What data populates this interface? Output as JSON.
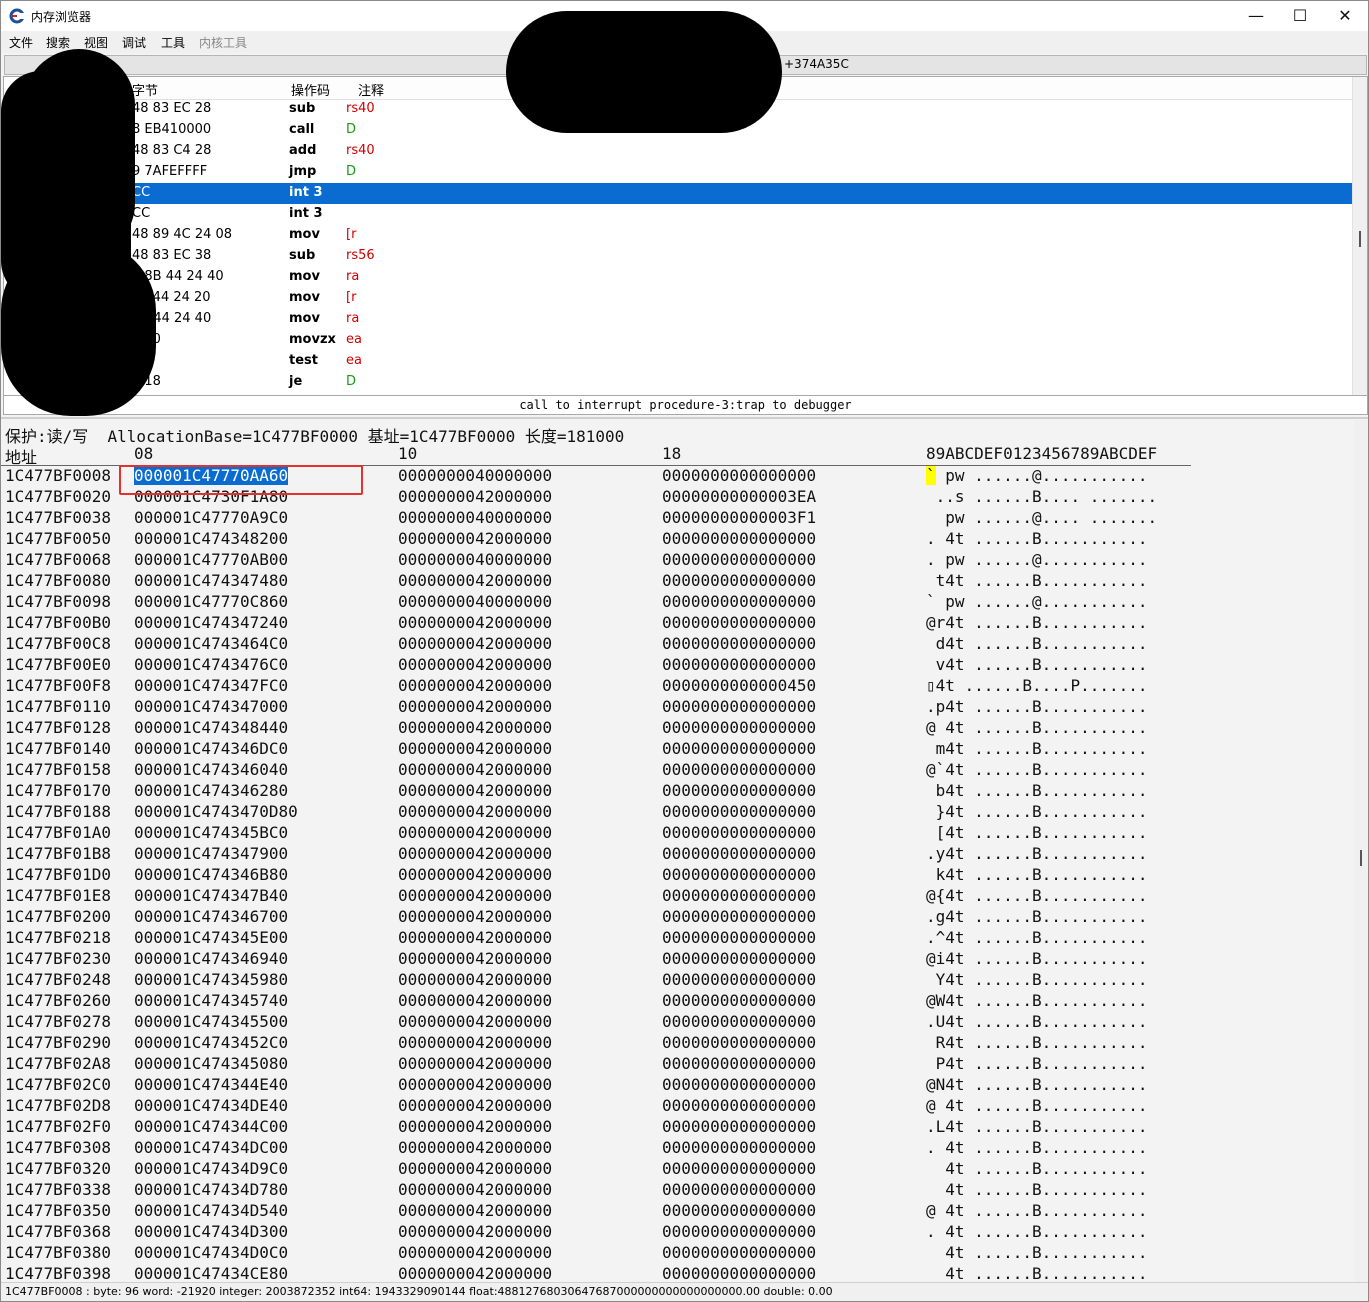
{
  "window": {
    "title": "内存浏览器",
    "controls": {
      "minimize": "—",
      "maximize": "☐",
      "close": "✕"
    }
  },
  "menu": [
    "文件",
    "搜索",
    "视图",
    "调试",
    "工具",
    "内核工具"
  ],
  "address_bar": "+374A35C",
  "disasm": {
    "headers": {
      "bytes": "字节",
      "opcode": "操作码",
      "comment": "注释"
    },
    "rows": [
      {
        "bytes": "48 83 EC 28",
        "op": "sub",
        "comment": "rs40",
        "color": "red"
      },
      {
        "bytes": "8 EB410000",
        "op": "call",
        "comment": "D",
        "color": "green"
      },
      {
        "bytes": "48 83 C4 28",
        "op": "add",
        "comment": "rs40",
        "color": "red"
      },
      {
        "bytes": "9 7AFEFFFF",
        "op": "jmp",
        "comment": "D",
        "color": "green"
      },
      {
        "bytes": "CC",
        "op": "int 3",
        "comment": "",
        "color": "red",
        "selected": true
      },
      {
        "bytes": "CC",
        "op": "int 3",
        "comment": "",
        "color": "red"
      },
      {
        "bytes": "48 89 4C 24 08",
        "op": "mov",
        "comment": "[r",
        "color": "red"
      },
      {
        "bytes": "48 83 EC 38",
        "op": "sub",
        "comment": "rs56",
        "color": "red"
      },
      {
        "bytes": "8 8B 44 24 40",
        "op": "mov",
        "comment": "ra",
        "color": "red"
      },
      {
        "bytes": "89 44 24 20",
        "op": "mov",
        "comment": "[r",
        "color": "red"
      },
      {
        "bytes": "8B 44 24 40",
        "op": "mov",
        "comment": "ra",
        "color": "red"
      },
      {
        "bytes": "6 00",
        "op": "movzx",
        "comment": "ea",
        "color": "red"
      },
      {
        "bytes": "C0",
        "op": "test",
        "comment": "ea",
        "color": "red"
      },
      {
        "bytes": "4 18",
        "op": "je",
        "comment": "D",
        "color": "green"
      }
    ]
  },
  "info_line": "call to interrupt procedure-3:trap to debugger",
  "hex": {
    "info": "保护:读/写  AllocationBase=1C477BF0000 基址=1C477BF0000 长度=181000",
    "headers": {
      "addr": "地址",
      "c0": "08",
      "c1": "10",
      "c2": "18",
      "ascii": "89ABCDEF0123456789ABCDEF"
    },
    "rows": [
      {
        "addr": "1C477BF0008",
        "c0": "000001C47770AA60",
        "c1": "0000000040000000",
        "c2": "0000000000000000",
        "ascii": "` pw ......@..........."
      },
      {
        "addr": "1C477BF0020",
        "c0": "000001C4730F1A80",
        "c1": "0000000042000000",
        "c2": "00000000000003EA",
        "ascii": " ..s ......B.... ......."
      },
      {
        "addr": "1C477BF0038",
        "c0": "000001C47770A9C0",
        "c1": "0000000040000000",
        "c2": "00000000000003F1",
        "ascii": "  pw ......@.... ......."
      },
      {
        "addr": "1C477BF0050",
        "c0": "000001C474348200",
        "c1": "0000000042000000",
        "c2": "0000000000000000",
        "ascii": ". 4t ......B..........."
      },
      {
        "addr": "1C477BF0068",
        "c0": "000001C47770AB00",
        "c1": "0000000040000000",
        "c2": "0000000000000000",
        "ascii": ". pw ......@..........."
      },
      {
        "addr": "1C477BF0080",
        "c0": "000001C474347480",
        "c1": "0000000042000000",
        "c2": "0000000000000000",
        "ascii": " t4t ......B..........."
      },
      {
        "addr": "1C477BF0098",
        "c0": "000001C47770C860",
        "c1": "0000000040000000",
        "c2": "0000000000000000",
        "ascii": "` pw ......@..........."
      },
      {
        "addr": "1C477BF00B0",
        "c0": "000001C474347240",
        "c1": "0000000042000000",
        "c2": "0000000000000000",
        "ascii": "@r4t ......B..........."
      },
      {
        "addr": "1C477BF00C8",
        "c0": "000001C4743464C0",
        "c1": "0000000042000000",
        "c2": "0000000000000000",
        "ascii": " d4t ......B..........."
      },
      {
        "addr": "1C477BF00E0",
        "c0": "000001C4743476C0",
        "c1": "0000000042000000",
        "c2": "0000000000000000",
        "ascii": " v4t ......B..........."
      },
      {
        "addr": "1C477BF00F8",
        "c0": "000001C474347FC0",
        "c1": "0000000042000000",
        "c2": "0000000000000450",
        "ascii": "▯4t ......B....P......."
      },
      {
        "addr": "1C477BF0110",
        "c0": "000001C474347000",
        "c1": "0000000042000000",
        "c2": "0000000000000000",
        "ascii": ".p4t ......B..........."
      },
      {
        "addr": "1C477BF0128",
        "c0": "000001C474348440",
        "c1": "0000000042000000",
        "c2": "0000000000000000",
        "ascii": "@ 4t ......B..........."
      },
      {
        "addr": "1C477BF0140",
        "c0": "000001C474346DC0",
        "c1": "0000000042000000",
        "c2": "0000000000000000",
        "ascii": " m4t ......B..........."
      },
      {
        "addr": "1C477BF0158",
        "c0": "000001C474346040",
        "c1": "0000000042000000",
        "c2": "0000000000000000",
        "ascii": "@`4t ......B..........."
      },
      {
        "addr": "1C477BF0170",
        "c0": "000001C474346280",
        "c1": "0000000042000000",
        "c2": "0000000000000000",
        "ascii": " b4t ......B..........."
      },
      {
        "addr": "1C477BF0188",
        "c0": "000001C4743470D80",
        "c1": "0000000042000000",
        "c2": "0000000000000000",
        "ascii": " }4t ......B..........."
      },
      {
        "addr": "1C477BF01A0",
        "c0": "000001C474345BC0",
        "c1": "0000000042000000",
        "c2": "0000000000000000",
        "ascii": " [4t ......B..........."
      },
      {
        "addr": "1C477BF01B8",
        "c0": "000001C474347900",
        "c1": "0000000042000000",
        "c2": "0000000000000000",
        "ascii": ".y4t ......B..........."
      },
      {
        "addr": "1C477BF01D0",
        "c0": "000001C474346B80",
        "c1": "0000000042000000",
        "c2": "0000000000000000",
        "ascii": " k4t ......B..........."
      },
      {
        "addr": "1C477BF01E8",
        "c0": "000001C474347B40",
        "c1": "0000000042000000",
        "c2": "0000000000000000",
        "ascii": "@{4t ......B..........."
      },
      {
        "addr": "1C477BF0200",
        "c0": "000001C474346700",
        "c1": "0000000042000000",
        "c2": "0000000000000000",
        "ascii": ".g4t ......B..........."
      },
      {
        "addr": "1C477BF0218",
        "c0": "000001C474345E00",
        "c1": "0000000042000000",
        "c2": "0000000000000000",
        "ascii": ".^4t ......B..........."
      },
      {
        "addr": "1C477BF0230",
        "c0": "000001C474346940",
        "c1": "0000000042000000",
        "c2": "0000000000000000",
        "ascii": "@i4t ......B..........."
      },
      {
        "addr": "1C477BF0248",
        "c0": "000001C474345980",
        "c1": "0000000042000000",
        "c2": "0000000000000000",
        "ascii": " Y4t ......B..........."
      },
      {
        "addr": "1C477BF0260",
        "c0": "000001C474345740",
        "c1": "0000000042000000",
        "c2": "0000000000000000",
        "ascii": "@W4t ......B..........."
      },
      {
        "addr": "1C477BF0278",
        "c0": "000001C474345500",
        "c1": "0000000042000000",
        "c2": "0000000000000000",
        "ascii": ".U4t ......B..........."
      },
      {
        "addr": "1C477BF0290",
        "c0": "000001C4743452C0",
        "c1": "0000000042000000",
        "c2": "0000000000000000",
        "ascii": " R4t ......B..........."
      },
      {
        "addr": "1C477BF02A8",
        "c0": "000001C474345080",
        "c1": "0000000042000000",
        "c2": "0000000000000000",
        "ascii": " P4t ......B..........."
      },
      {
        "addr": "1C477BF02C0",
        "c0": "000001C474344E40",
        "c1": "0000000042000000",
        "c2": "0000000000000000",
        "ascii": "@N4t ......B..........."
      },
      {
        "addr": "1C477BF02D8",
        "c0": "000001C47434DE40",
        "c1": "0000000042000000",
        "c2": "0000000000000000",
        "ascii": "@ 4t ......B..........."
      },
      {
        "addr": "1C477BF02F0",
        "c0": "000001C474344C00",
        "c1": "0000000042000000",
        "c2": "0000000000000000",
        "ascii": ".L4t ......B..........."
      },
      {
        "addr": "1C477BF0308",
        "c0": "000001C47434DC00",
        "c1": "0000000042000000",
        "c2": "0000000000000000",
        "ascii": ". 4t ......B..........."
      },
      {
        "addr": "1C477BF0320",
        "c0": "000001C47434D9C0",
        "c1": "0000000042000000",
        "c2": "0000000000000000",
        "ascii": "  4t ......B..........."
      },
      {
        "addr": "1C477BF0338",
        "c0": "000001C47434D780",
        "c1": "0000000042000000",
        "c2": "0000000000000000",
        "ascii": "  4t ......B..........."
      },
      {
        "addr": "1C477BF0350",
        "c0": "000001C47434D540",
        "c1": "0000000042000000",
        "c2": "0000000000000000",
        "ascii": "@ 4t ......B..........."
      },
      {
        "addr": "1C477BF0368",
        "c0": "000001C47434D300",
        "c1": "0000000042000000",
        "c2": "0000000000000000",
        "ascii": ". 4t ......B..........."
      },
      {
        "addr": "1C477BF0380",
        "c0": "000001C47434D0C0",
        "c1": "0000000042000000",
        "c2": "0000000000000000",
        "ascii": "  4t ......B..........."
      },
      {
        "addr": "1C477BF0398",
        "c0": "000001C47434CE80",
        "c1": "0000000042000000",
        "c2": "0000000000000000",
        "ascii": "  4t ......B..........."
      }
    ]
  },
  "status": "1C477BF0008 : byte: 96 word: -21920 integer: 2003872352 int64: 1943329090144 float:48812768030647687000000000000000000.00 double: 0.00",
  "colors": {
    "selection": "#0a6cd0",
    "highlight_box": "#e0332f",
    "comment_red": "#d10000",
    "comment_green": "#1a9a1a"
  }
}
